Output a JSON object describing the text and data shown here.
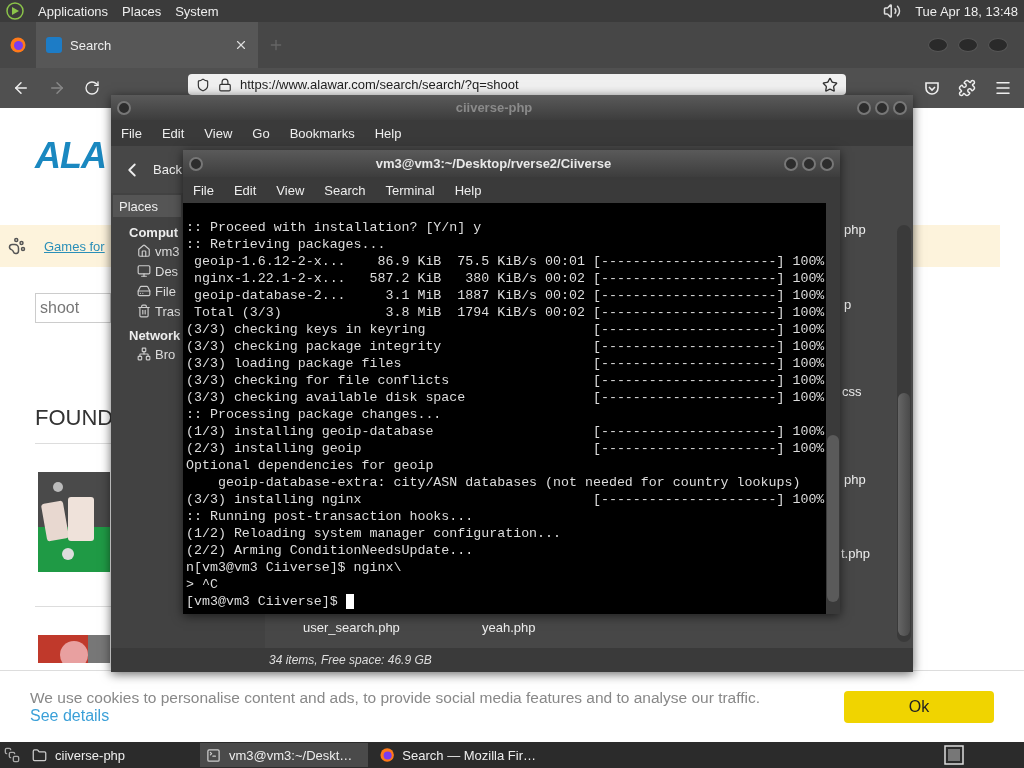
{
  "top_panel": {
    "menus": [
      "Applications",
      "Places",
      "System"
    ],
    "clock": "Tue Apr 18, 13:48"
  },
  "browser": {
    "tabs": [
      {
        "title": "Search",
        "selected": true
      }
    ],
    "url": "https://www.alawar.com/search/search/?q=shoot",
    "page": {
      "logo": "ALA",
      "banner_link": "Games for",
      "search": {
        "value": "shoot"
      },
      "heading": "FOUND",
      "cookie": {
        "text": "We use cookies to personalise content and ads, to provide social media features and to analyse our traffic.",
        "link": "See details",
        "button": "Ok"
      }
    }
  },
  "file_manager": {
    "title": "ciiverse-php",
    "menu": [
      "File",
      "Edit",
      "View",
      "Go",
      "Bookmarks",
      "Help"
    ],
    "back": "Back",
    "sidebar": {
      "header": "Places",
      "sections": [
        {
          "label": "Comput",
          "items": [
            {
              "label": "vm3"
            },
            {
              "label": "Des"
            },
            {
              "label": "File"
            },
            {
              "label": "Tras"
            }
          ]
        },
        {
          "label": "Network",
          "items": [
            {
              "label": "Bro"
            }
          ]
        }
      ]
    },
    "files": [
      "php",
      "p",
      "css",
      "php",
      "t.php",
      "user_search.php",
      "yeah.php"
    ],
    "status": "34 items, Free space: 46.9 GB"
  },
  "terminal": {
    "title": "vm3@vm3:~/Desktop/rverse2/Ciiverse",
    "menu": [
      "File",
      "Edit",
      "View",
      "Search",
      "Terminal",
      "Help"
    ],
    "lines": [
      {
        "text": ":: Proceed with installation? [Y/n] y"
      },
      {
        "text": ":: Retrieving packages..."
      },
      {
        "text": " geoip-1.6.12-2-x...    86.9 KiB  75.5 KiB/s 00:01",
        "bar": "[----------------------] 100%"
      },
      {
        "text": " nginx-1.22.1-2-x...   587.2 KiB   380 KiB/s 00:02",
        "bar": "[----------------------] 100%"
      },
      {
        "text": " geoip-database-2...     3.1 MiB  1887 KiB/s 00:02",
        "bar": "[----------------------] 100%"
      },
      {
        "text": " Total (3/3)             3.8 MiB  1794 KiB/s 00:02",
        "bar": "[----------------------] 100%"
      },
      {
        "text": "(3/3) checking keys in keyring",
        "bar": "[----------------------] 100%"
      },
      {
        "text": "(3/3) checking package integrity",
        "bar": "[----------------------] 100%"
      },
      {
        "text": "(3/3) loading package files",
        "bar": "[----------------------] 100%"
      },
      {
        "text": "(3/3) checking for file conflicts",
        "bar": "[----------------------] 100%"
      },
      {
        "text": "(3/3) checking available disk space",
        "bar": "[----------------------] 100%"
      },
      {
        "text": ":: Processing package changes..."
      },
      {
        "text": "(1/3) installing geoip-database",
        "bar": "[----------------------] 100%"
      },
      {
        "text": "(2/3) installing geoip",
        "bar": "[----------------------] 100%"
      },
      {
        "text": "Optional dependencies for geoip"
      },
      {
        "text": "    geoip-database-extra: city/ASN databases (not needed for country lookups)"
      },
      {
        "text": "(3/3) installing nginx",
        "bar": "[----------------------] 100%"
      },
      {
        "text": ":: Running post-transaction hooks..."
      },
      {
        "text": "(1/2) Reloading system manager configuration..."
      },
      {
        "text": "(2/2) Arming ConditionNeedsUpdate..."
      },
      {
        "text": "n[vm3@vm3 Ciiverse]$ nginx\\"
      },
      {
        "text": "> ^C"
      },
      {
        "text": "[vm3@vm3 Ciiverse]$ "
      }
    ]
  },
  "taskbar": {
    "tasks": [
      {
        "label": "ciiverse-php",
        "selected": false
      },
      {
        "label": "vm3@vm3:~/Deskt…",
        "selected": true
      },
      {
        "label": "Search — Mozilla Fir…",
        "selected": false
      }
    ]
  }
}
